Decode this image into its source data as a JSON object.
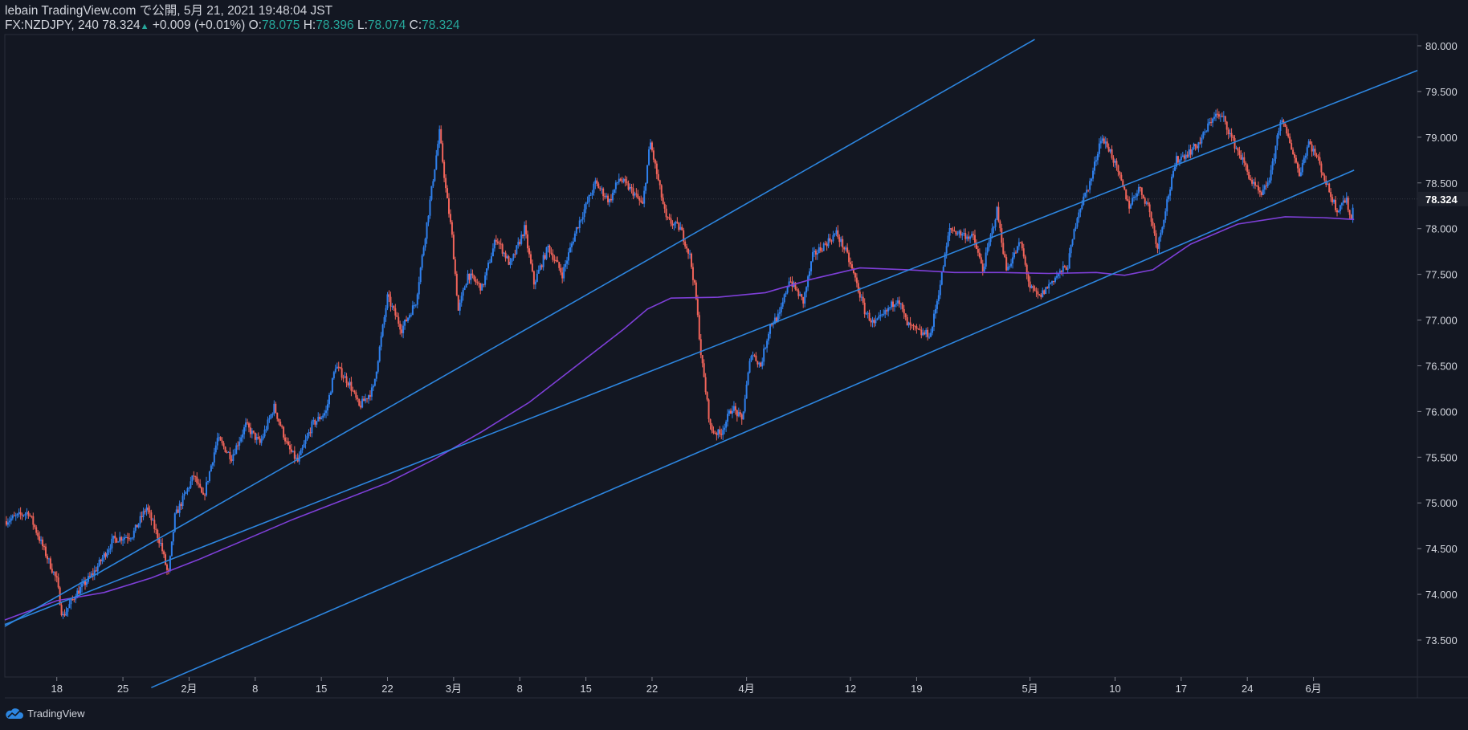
{
  "header": {
    "publish_line": "lebain TradingView.com で公開, 5月 21, 2021 19:48:04 JST",
    "symbol": "FX:NZDJPY, 240",
    "last": "78.324",
    "change": "+0.009 (+0.01%)",
    "o_label": "O:",
    "o_value": "78.075",
    "h_label": "H:",
    "h_value": "78.396",
    "l_label": "L:",
    "l_value": "78.074",
    "c_label": "C:",
    "c_value": "78.324"
  },
  "footer": {
    "brand": "TradingView"
  },
  "colors": {
    "background": "#131722",
    "up": "#2f80ed",
    "down": "#f0645a",
    "ma": "#7e3fd8",
    "trendline": "#2d86e0",
    "text": "#d1d4dc",
    "header_value": "#26a69a"
  },
  "chart_data": {
    "type": "candlestick",
    "symbol": "FX:NZDJPY",
    "timeframe": "240",
    "ylim": [
      73.0,
      80.1
    ],
    "y_ticks": [
      "80.000",
      "79.500",
      "79.000",
      "78.500",
      "78.000",
      "77.500",
      "77.000",
      "76.500",
      "76.000",
      "75.500",
      "75.000",
      "74.500",
      "74.000",
      "73.500"
    ],
    "last_price_label": "78.324",
    "x_tick_labels": [
      "18",
      "25",
      "2月",
      "8",
      "15",
      "22",
      "3月",
      "8",
      "15",
      "22",
      "4月",
      "12",
      "19",
      "5月",
      "10",
      "17",
      "24",
      "6月"
    ],
    "x_tick_days": [
      0,
      7,
      14,
      21,
      28,
      35,
      42,
      49,
      56,
      63,
      73,
      84,
      91,
      103,
      112,
      119,
      126,
      133
    ],
    "x_range_days": [
      -5.5,
      144
    ],
    "anchors": [
      [
        -5.5,
        74.8
      ],
      [
        -3,
        74.9
      ],
      [
        -2,
        74.65
      ],
      [
        0,
        74.15
      ],
      [
        0.6,
        73.75
      ],
      [
        2,
        74.0
      ],
      [
        4,
        74.25
      ],
      [
        6,
        74.6
      ],
      [
        8,
        74.65
      ],
      [
        9.5,
        74.95
      ],
      [
        11,
        74.55
      ],
      [
        11.8,
        74.2
      ],
      [
        12.5,
        74.85
      ],
      [
        14.5,
        75.3
      ],
      [
        15.5,
        75.05
      ],
      [
        17,
        75.7
      ],
      [
        18.5,
        75.5
      ],
      [
        20,
        75.85
      ],
      [
        21.5,
        75.65
      ],
      [
        23,
        76.05
      ],
      [
        24.5,
        75.6
      ],
      [
        25.5,
        75.45
      ],
      [
        27,
        75.85
      ],
      [
        28.5,
        76.0
      ],
      [
        29.5,
        76.5
      ],
      [
        31,
        76.3
      ],
      [
        32,
        76.05
      ],
      [
        33.5,
        76.25
      ],
      [
        35,
        77.25
      ],
      [
        36.5,
        76.9
      ],
      [
        38,
        77.2
      ],
      [
        39.5,
        78.3
      ],
      [
        40.5,
        79.05
      ],
      [
        41.2,
        78.4
      ],
      [
        41.8,
        77.95
      ],
      [
        42.5,
        77.1
      ],
      [
        43.5,
        77.5
      ],
      [
        45,
        77.35
      ],
      [
        46.5,
        77.9
      ],
      [
        48,
        77.6
      ],
      [
        49.5,
        78.0
      ],
      [
        50.5,
        77.4
      ],
      [
        52,
        77.8
      ],
      [
        53.5,
        77.5
      ],
      [
        55,
        78.0
      ],
      [
        57,
        78.5
      ],
      [
        58.5,
        78.3
      ],
      [
        59.5,
        78.55
      ],
      [
        61,
        78.4
      ],
      [
        62,
        78.25
      ],
      [
        62.8,
        78.95
      ],
      [
        64.5,
        78.1
      ],
      [
        66,
        78.0
      ],
      [
        67,
        77.7
      ],
      [
        67.6,
        77.3
      ],
      [
        68.2,
        76.6
      ],
      [
        69.2,
        75.8
      ],
      [
        70.2,
        75.75
      ],
      [
        71.5,
        76.05
      ],
      [
        72.5,
        75.9
      ],
      [
        73.5,
        76.65
      ],
      [
        74.5,
        76.5
      ],
      [
        75.5,
        76.95
      ],
      [
        76.5,
        77.05
      ],
      [
        77.5,
        77.45
      ],
      [
        79,
        77.2
      ],
      [
        80,
        77.7
      ],
      [
        81,
        77.8
      ],
      [
        82.5,
        77.95
      ],
      [
        83.5,
        77.75
      ],
      [
        84.5,
        77.45
      ],
      [
        85.5,
        77.1
      ],
      [
        86.5,
        76.95
      ],
      [
        87.5,
        77.05
      ],
      [
        89,
        77.25
      ],
      [
        90,
        76.95
      ],
      [
        91.5,
        76.85
      ],
      [
        92.5,
        76.85
      ],
      [
        93.5,
        77.4
      ],
      [
        94.5,
        78.0
      ],
      [
        95.5,
        77.95
      ],
      [
        97,
        77.9
      ],
      [
        98,
        77.55
      ],
      [
        99.5,
        78.2
      ],
      [
        100.5,
        77.55
      ],
      [
        102,
        77.85
      ],
      [
        103,
        77.35
      ],
      [
        104,
        77.25
      ],
      [
        105.5,
        77.45
      ],
      [
        107,
        77.6
      ],
      [
        108,
        78.15
      ],
      [
        109.5,
        78.55
      ],
      [
        110.5,
        79.0
      ],
      [
        111.5,
        78.85
      ],
      [
        112.5,
        78.55
      ],
      [
        113.5,
        78.25
      ],
      [
        114.5,
        78.45
      ],
      [
        115.5,
        78.25
      ],
      [
        116.5,
        77.8
      ],
      [
        117.5,
        78.3
      ],
      [
        118.5,
        78.75
      ],
      [
        120,
        78.85
      ],
      [
        121,
        78.95
      ],
      [
        122.5,
        79.25
      ],
      [
        123.5,
        79.2
      ],
      [
        124.5,
        78.95
      ],
      [
        125.5,
        78.75
      ],
      [
        126.5,
        78.5
      ],
      [
        127.5,
        78.35
      ],
      [
        128.5,
        78.6
      ],
      [
        129.5,
        79.2
      ],
      [
        130.5,
        78.95
      ],
      [
        131.5,
        78.6
      ],
      [
        132.5,
        78.95
      ],
      [
        133.5,
        78.75
      ],
      [
        134.5,
        78.45
      ],
      [
        135.5,
        78.2
      ],
      [
        136,
        78.3
      ],
      [
        136.5,
        78.3
      ],
      [
        137,
        78.1
      ],
      [
        137.3,
        78.32
      ]
    ],
    "moving_average": [
      [
        -5.5,
        73.72
      ],
      [
        0,
        73.93
      ],
      [
        5,
        74.02
      ],
      [
        10,
        74.18
      ],
      [
        15,
        74.38
      ],
      [
        20,
        74.6
      ],
      [
        25,
        74.82
      ],
      [
        30,
        75.02
      ],
      [
        35,
        75.22
      ],
      [
        40,
        75.48
      ],
      [
        45,
        75.78
      ],
      [
        50,
        76.1
      ],
      [
        55,
        76.5
      ],
      [
        60,
        76.9
      ],
      [
        62.5,
        77.12
      ],
      [
        65,
        77.24
      ],
      [
        70,
        77.25
      ],
      [
        75,
        77.3
      ],
      [
        80,
        77.45
      ],
      [
        85,
        77.57
      ],
      [
        90,
        77.55
      ],
      [
        95,
        77.52
      ],
      [
        100,
        77.52
      ],
      [
        105,
        77.51
      ],
      [
        110,
        77.52
      ],
      [
        113,
        77.49
      ],
      [
        116,
        77.55
      ],
      [
        120,
        77.83
      ],
      [
        125,
        78.05
      ],
      [
        130,
        78.13
      ],
      [
        134,
        78.12
      ],
      [
        137.3,
        78.1
      ]
    ],
    "trendlines": [
      {
        "from": [
          -5.5,
          73.65
        ],
        "to": [
          103.5,
          80.07
        ]
      },
      {
        "from": [
          -5.5,
          73.67
        ],
        "to": [
          144,
          79.73
        ]
      },
      {
        "from": [
          10,
          72.98
        ],
        "to": [
          137.3,
          78.64
        ]
      }
    ],
    "series": [
      {
        "name": "NZDJPY"
      },
      {
        "name": "MA"
      }
    ]
  }
}
